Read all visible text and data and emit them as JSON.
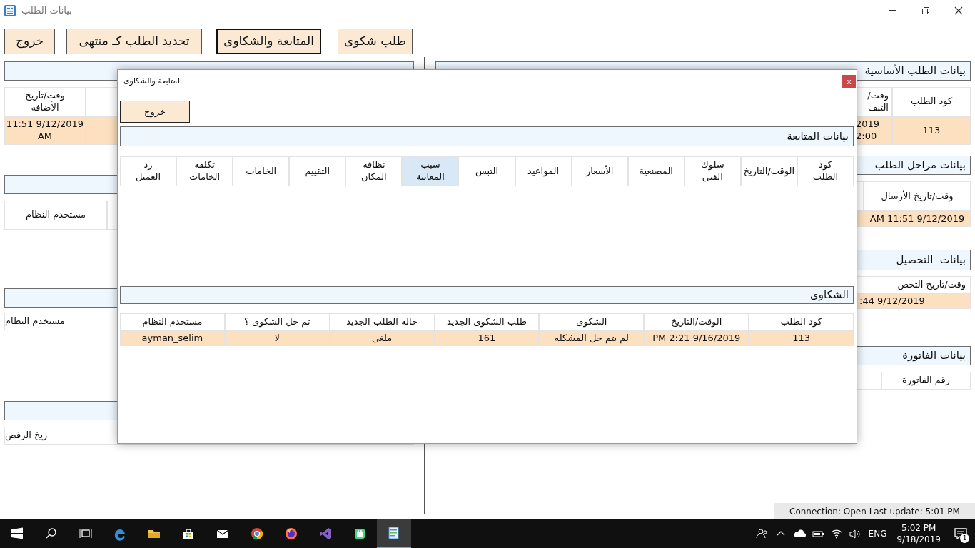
{
  "window": {
    "title": "بيانات الطلب"
  },
  "toolbar": [
    {
      "label": "طلب شكوى",
      "focused": false
    },
    {
      "label": "المتابعة والشكاوى",
      "focused": true
    },
    {
      "label": "تحديد الطلب كـ منتهى",
      "focused": false
    },
    {
      "label": "خروج",
      "focused": false
    }
  ],
  "left_panel": [
    {
      "columns": [
        {
          "header": "وقت/تاريخ\nالأضافة",
          "value": "11:51 9/12/2019\nAM"
        }
      ]
    },
    {
      "columns": [
        {
          "header": "مستخدم النظام"
        }
      ]
    },
    {
      "columns": [
        {
          "header": "مستخدم النظام"
        }
      ]
    },
    {
      "columns": [
        {
          "header": "ريخ الرفض"
        }
      ]
    }
  ],
  "right_panel": [
    {
      "title": "بيانات الطلب الأساسية",
      "columns": [
        {
          "header": "كود الطلب",
          "value": "113"
        },
        {
          "header": "وقت/\nالتنف",
          "value": "2019\n2:00"
        }
      ]
    },
    {
      "title": "بيانات مراحل الطلب",
      "columns": [
        {
          "header": "وقت/تاريخ الأرسال",
          "value": "AM 11:51 9/12/2019"
        }
      ]
    },
    {
      "title": "بيانات  التحصيل",
      "columns": [
        {
          "header": "وقت/تاريخ التحص",
          "value": ":44 9/12/2019"
        }
      ]
    },
    {
      "title": "بيانات الفاتورة",
      "columns": [
        {
          "header": "رقم الفاتورة"
        }
      ]
    }
  ],
  "dialog": {
    "title": "المتابعة والشكاوى",
    "close": "x",
    "exit_button": "خروج",
    "followup": {
      "title": "بيانات المتابعة",
      "columns": [
        {
          "label": "كود\nالطلب",
          "selected": false
        },
        {
          "label": "الوقت/التاريخ",
          "selected": false
        },
        {
          "label": "سلوك\nالفنى",
          "selected": false
        },
        {
          "label": "المصنعية",
          "selected": false
        },
        {
          "label": "الأسعار",
          "selected": false
        },
        {
          "label": "المواعيد",
          "selected": false
        },
        {
          "label": "التبس",
          "selected": false
        },
        {
          "label": "سبب\nالمعاينة",
          "selected": true
        },
        {
          "label": "نظافة\nالمكان",
          "selected": false
        },
        {
          "label": "التقييم",
          "selected": false
        },
        {
          "label": "الخامات",
          "selected": false
        },
        {
          "label": "تكلفة\nالخامات",
          "selected": false
        },
        {
          "label": "رد\nالعميل",
          "selected": false
        }
      ]
    },
    "complaints": {
      "title": "الشكاوى",
      "columns": [
        "كود الطلب",
        "الوقت/التاريخ",
        "الشكوى",
        "طلب الشكوى الجديد",
        "حالة الطلب الجديد",
        "تم حل الشكوى ؟",
        "مستخدم النظام"
      ],
      "rows": [
        [
          "113",
          "PM 2:21 9/16/2019",
          "لم يتم حل المشكله",
          "161",
          "ملغى",
          "لا",
          "ayman_selim"
        ]
      ]
    }
  },
  "status_bar": "Connection: Open Last update: 5:01 PM",
  "taskbar": {
    "apps": [
      {
        "kind": "start",
        "active": false
      },
      {
        "kind": "search",
        "active": false
      },
      {
        "kind": "taskview",
        "active": false
      },
      {
        "kind": "edge",
        "active": false
      },
      {
        "kind": "folder",
        "active": false
      },
      {
        "kind": "store",
        "active": false
      },
      {
        "kind": "mail",
        "active": false
      },
      {
        "kind": "chrome",
        "active": false
      },
      {
        "kind": "firefox",
        "active": false
      },
      {
        "kind": "vs",
        "active": false
      },
      {
        "kind": "android",
        "active": false
      },
      {
        "kind": "app",
        "active": true
      }
    ],
    "language": "ENG",
    "time": "5:02 PM",
    "date": "9/18/2019",
    "notifications": "1"
  }
}
